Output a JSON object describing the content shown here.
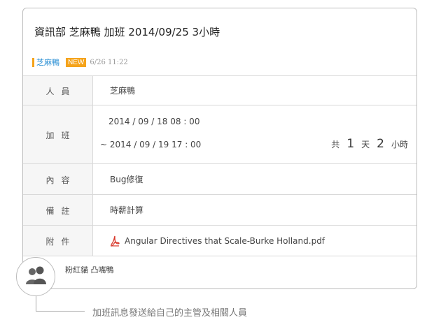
{
  "post": {
    "title": "資訊部 芝麻鴨 加班 2014/09/25 3小時",
    "author": "芝麻鴨",
    "badge": "NEW",
    "date": "6/26 11:22"
  },
  "rows": {
    "person": {
      "label": "人員",
      "value": "芝麻鴨"
    },
    "overtime": {
      "label": "加班",
      "start": "2014 / 09 / 18   08 : 00",
      "end": "~ 2014 / 09 / 19   17 : 00",
      "total_prefix": "共",
      "days": "1",
      "days_unit": "天",
      "hours": "2",
      "hours_unit": "小時"
    },
    "content": {
      "label": "內容",
      "value": "Bug修復"
    },
    "note": {
      "label": "備註",
      "value": "時薪計算"
    },
    "attachment": {
      "label": "附件",
      "file_name": "Angular Directives that Scale-Burke Holland.pdf",
      "icon": "pdf-icon"
    },
    "recipients": {
      "value": "粉紅貓   凸嘴鴨",
      "icon": "people-icon"
    }
  },
  "caption": "加班訊息發送給自己的主管及相關人員",
  "colors": {
    "accent": "#f5a31a",
    "author": "#2a8fd4"
  }
}
